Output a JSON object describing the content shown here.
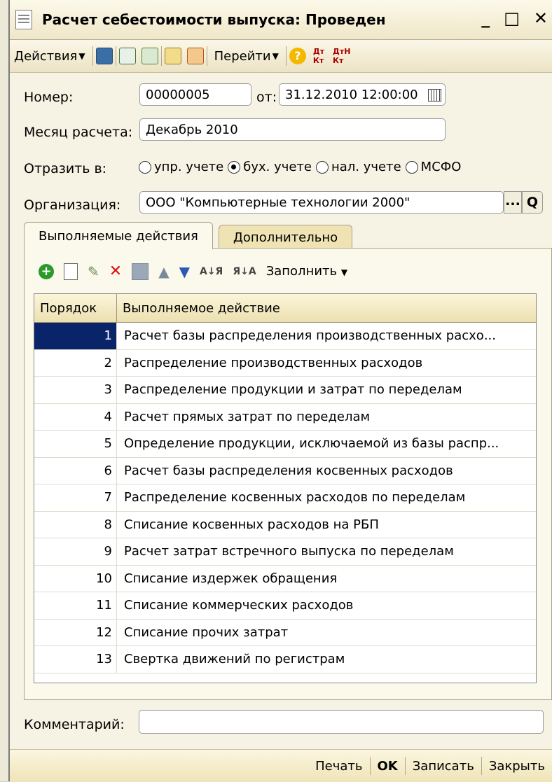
{
  "window": {
    "title": "Расчет себестоимости выпуска: Проведен",
    "minimize": "_",
    "maximize": "□",
    "close": "✕"
  },
  "toolbar": {
    "actions": "Действия",
    "goto": "Перейти",
    "help": "?",
    "dt_kt": "Дт/Кт",
    "dt_kt_n": "ДтН/Кт"
  },
  "form": {
    "number_label": "Номер:",
    "number_value": "00000005",
    "date_label": "от:",
    "date_value": "31.12.2010 12:00:00",
    "month_label": "Месяц расчета:",
    "month_value": "Декабрь 2010",
    "reflect_label": "Отразить в:",
    "reflect_options": [
      {
        "label": "упр. учете",
        "selected": false
      },
      {
        "label": "бух. учете",
        "selected": true
      },
      {
        "label": "нал. учете",
        "selected": false
      },
      {
        "label": "МСФО",
        "selected": false
      }
    ],
    "org_label": "Организация:",
    "org_value": "ООО \"Компьютерные технологии 2000\"",
    "select_btn": "...",
    "search_btn": "Q",
    "comment_label": "Комментарий:",
    "comment_value": ""
  },
  "tabs": [
    {
      "label": "Выполняемые действия",
      "active": true
    },
    {
      "label": "Дополнительно",
      "active": false
    }
  ],
  "panel": {
    "fill": "Заполнить"
  },
  "table": {
    "headers": [
      "Порядок",
      "Выполняемое действие"
    ],
    "rows": [
      {
        "n": "1",
        "action": "Расчет базы распределения производственных расхо..."
      },
      {
        "n": "2",
        "action": "Распределение производственных расходов"
      },
      {
        "n": "3",
        "action": "Распределение продукции и затрат по переделам"
      },
      {
        "n": "4",
        "action": "Расчет прямых затрат по переделам"
      },
      {
        "n": "5",
        "action": "Определение продукции, исключаемой из базы распр..."
      },
      {
        "n": "6",
        "action": "Расчет базы распределения косвенных расходов"
      },
      {
        "n": "7",
        "action": "Распределение косвенных расходов по переделам"
      },
      {
        "n": "8",
        "action": "Списание косвенных расходов на РБП"
      },
      {
        "n": "9",
        "action": "Расчет затрат встречного выпуска по переделам"
      },
      {
        "n": "10",
        "action": "Списание издержек обращения"
      },
      {
        "n": "11",
        "action": "Списание коммерческих расходов"
      },
      {
        "n": "12",
        "action": "Списание прочих затрат"
      },
      {
        "n": "13",
        "action": "Свертка движений по регистрам"
      }
    ]
  },
  "footer": {
    "print": "Печать",
    "ok": "OK",
    "save": "Записать",
    "close": "Закрыть"
  }
}
